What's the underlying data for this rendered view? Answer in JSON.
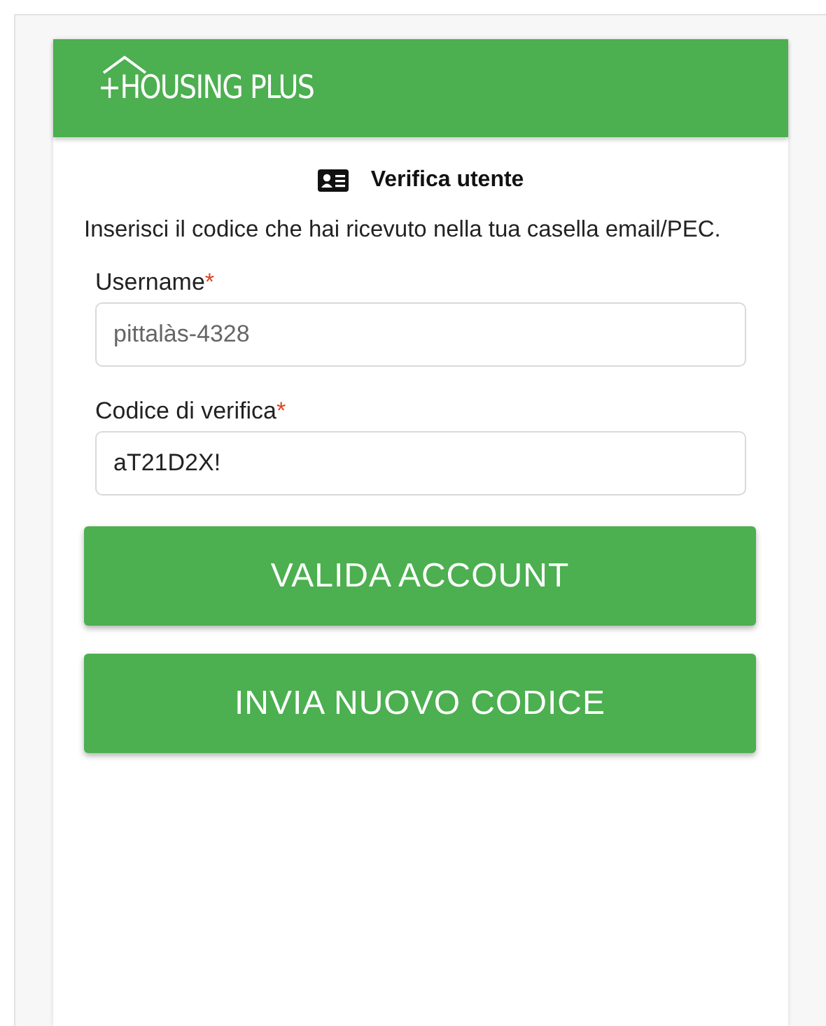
{
  "header": {
    "logo_text": "+HOUSING PLUS"
  },
  "title": "Verifica utente",
  "instructions": "Inserisci il codice che hai ricevuto nella tua casella email/PEC.",
  "fields": [
    {
      "label": "Username",
      "required_mark": "*",
      "value": "pittalàs-4328",
      "disabled": true
    },
    {
      "label": "Codice di verifica",
      "required_mark": "*",
      "value": "aT21D2X!",
      "disabled": false
    }
  ],
  "buttons": [
    "VALIDA ACCOUNT",
    "INVIA NUOVO CODICE"
  ]
}
